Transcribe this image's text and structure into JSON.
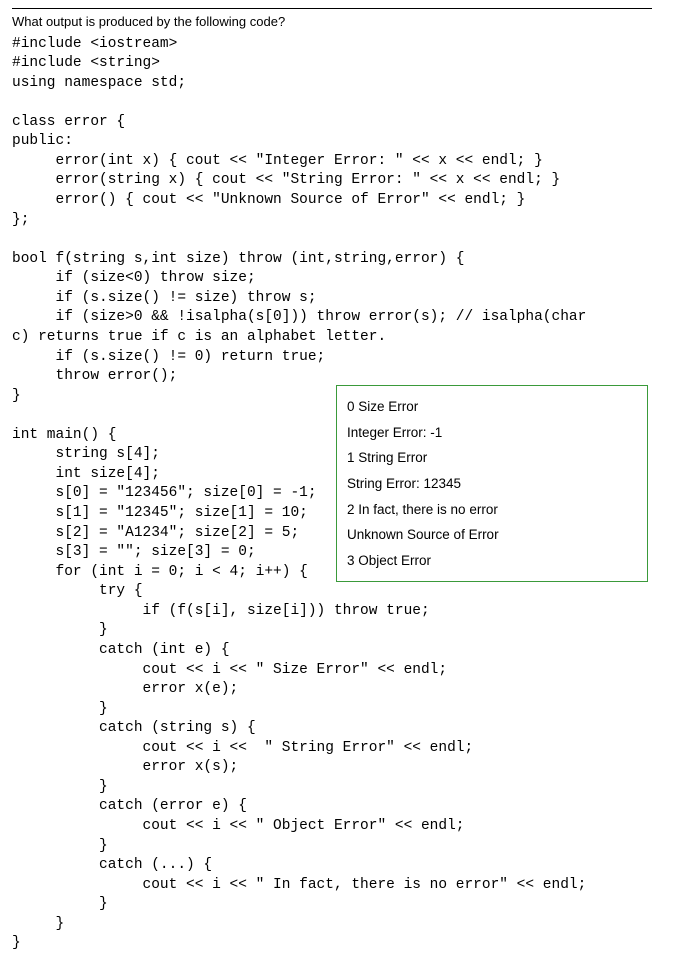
{
  "question": "What output is produced by the following code?",
  "code": "#include <iostream>\n#include <string>\nusing namespace std;\n\nclass error {\npublic:\n     error(int x) { cout << \"Integer Error: \" << x << endl; }\n     error(string x) { cout << \"String Error: \" << x << endl; }\n     error() { cout << \"Unknown Source of Error\" << endl; }\n};\n\nbool f(string s,int size) throw (int,string,error) {\n     if (size<0) throw size;\n     if (s.size() != size) throw s;\n     if (size>0 && !isalpha(s[0])) throw error(s); // isalpha(char\nc) returns true if c is an alphabet letter.\n     if (s.size() != 0) return true;\n     throw error();\n}\n\nint main() {\n     string s[4];\n     int size[4];\n     s[0] = \"123456\"; size[0] = -1;\n     s[1] = \"12345\"; size[1] = 10;\n     s[2] = \"A1234\"; size[2] = 5;\n     s[3] = \"\"; size[3] = 0;\n     for (int i = 0; i < 4; i++) {\n          try {\n               if (f(s[i], size[i])) throw true;\n          }\n          catch (int e) {\n               cout << i << \" Size Error\" << endl;\n               error x(e);\n          }\n          catch (string s) {\n               cout << i <<  \" String Error\" << endl;\n               error x(s);\n          }\n          catch (error e) {\n               cout << i << \" Object Error\" << endl;\n          }\n          catch (...) {\n               cout << i << \" In fact, there is no error\" << endl;\n          }\n     }\n}",
  "output": {
    "lines": [
      "0 Size Error",
      "Integer Error: -1",
      "1 String Error",
      "String Error: 12345",
      "2 In fact, there is no error",
      "Unknown Source of Error",
      "3 Object Error"
    ]
  }
}
